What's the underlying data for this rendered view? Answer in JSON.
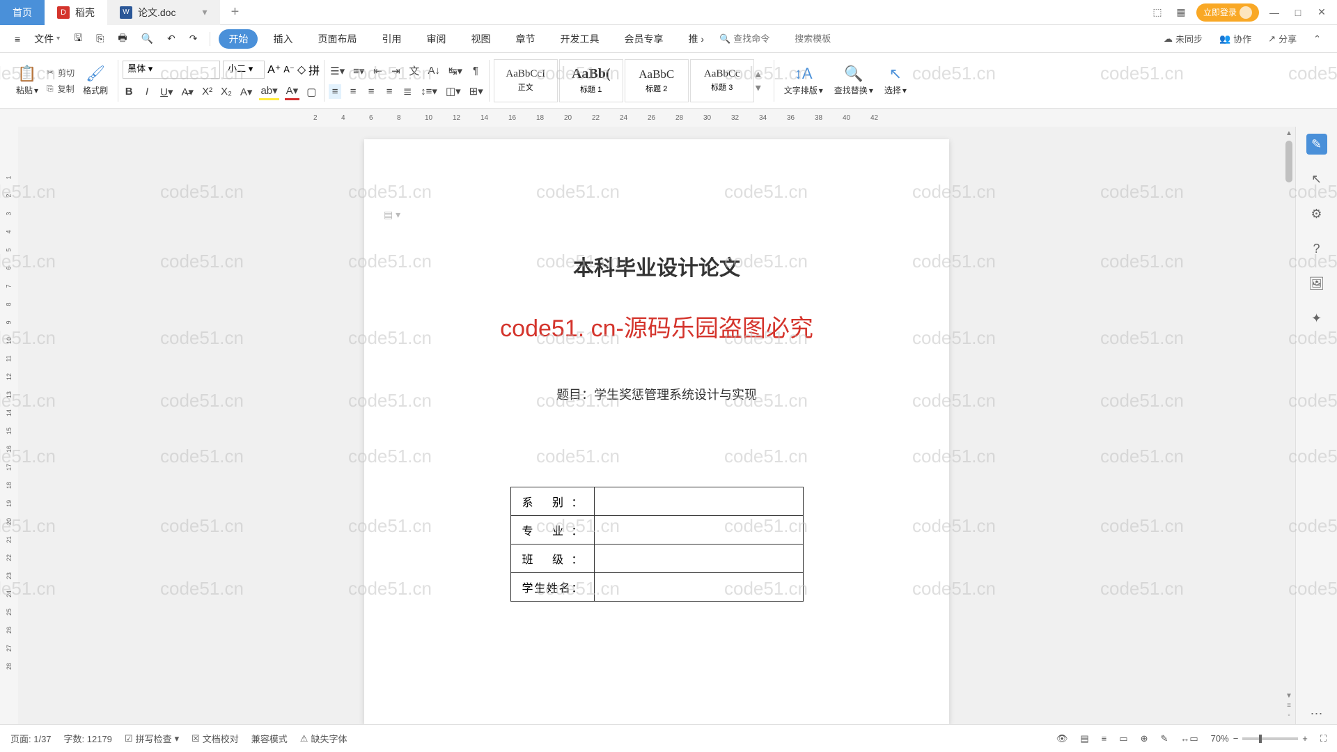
{
  "tabs": {
    "home": "首页",
    "daoke": "稻壳",
    "doc": "论文.doc"
  },
  "titleRight": {
    "login": "立即登录"
  },
  "menu": {
    "file": "文件",
    "items": [
      "开始",
      "插入",
      "页面布局",
      "引用",
      "审阅",
      "视图",
      "章节",
      "开发工具",
      "会员专享",
      "推"
    ],
    "searchCmd": "查找命令",
    "searchTpl": "搜索模板",
    "unsync": "未同步",
    "coop": "协作",
    "share": "分享"
  },
  "toolbar": {
    "paste": "粘贴",
    "cut": "剪切",
    "copy": "复制",
    "format": "格式刷",
    "font": "黑体",
    "size": "小二",
    "styles": [
      {
        "pv": "AaBbCcI",
        "nm": "正文"
      },
      {
        "pv": "AaBb(",
        "nm": "标题 1"
      },
      {
        "pv": "AaBbC",
        "nm": "标题 2"
      },
      {
        "pv": "AaBbCc",
        "nm": "标题 3"
      }
    ],
    "textLayout": "文字排版",
    "findReplace": "查找替换",
    "select": "选择"
  },
  "doc": {
    "title": "本科毕业设计论文",
    "watermark": "code51. cn-源码乐园盗图必究",
    "topicLabel": "题目：",
    "topic": "学生奖惩管理系统设计与实现",
    "fields": [
      "系    别：",
      "专    业：",
      "班    级：",
      "学生姓名："
    ]
  },
  "status": {
    "page": "页面: 1/37",
    "words": "字数: 12179",
    "spell": "拼写检查",
    "proof": "文档校对",
    "compat": "兼容模式",
    "missing": "缺失字体",
    "zoom": "70%"
  },
  "wm": "code51.cn"
}
